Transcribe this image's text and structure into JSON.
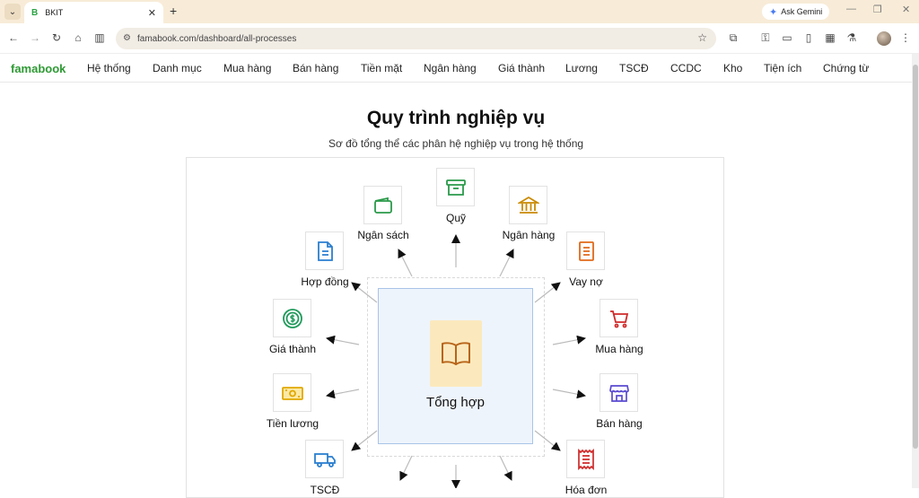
{
  "browser": {
    "tab_title": "BKIT",
    "tab_favicon": "B",
    "url": "famabook.com/dashboard/all-processes",
    "gemini_label": "Ask Gemini"
  },
  "nav": {
    "brand": "famabook",
    "items": [
      "Hệ thống",
      "Danh mục",
      "Mua hàng",
      "Bán hàng",
      "Tiền mặt",
      "Ngân hàng",
      "Giá thành",
      "Lương",
      "TSCĐ",
      "CCDC",
      "Kho",
      "Tiện ích",
      "Chứng từ"
    ]
  },
  "page": {
    "title": "Quy trình nghiệp vụ",
    "subtitle": "Sơ đồ tổng thể các phân hệ nghiệp vụ trong hệ thống",
    "center_label": "Tổng hợp"
  },
  "nodes": [
    {
      "label": "Quỹ",
      "icon": "archive-icon",
      "color": "#2a9a4a"
    },
    {
      "label": "Ngân sách",
      "icon": "wallet-icon",
      "color": "#2a9a4a"
    },
    {
      "label": "Ngân hàng",
      "icon": "bank-icon",
      "color": "#c98a00"
    },
    {
      "label": "Hợp đồng",
      "icon": "document-icon",
      "color": "#2a7fd0"
    },
    {
      "label": "Vay nợ",
      "icon": "document-icon",
      "color": "#e06a1a"
    },
    {
      "label": "Giá thành",
      "icon": "dollar-circle-icon",
      "color": "#1f9a5a"
    },
    {
      "label": "Mua hàng",
      "icon": "cart-icon",
      "color": "#d02a2a"
    },
    {
      "label": "Tiền lương",
      "icon": "banknote-icon",
      "color": "#e0a800"
    },
    {
      "label": "Bán hàng",
      "icon": "store-icon",
      "color": "#5a4ad0"
    },
    {
      "label": "TSCĐ",
      "icon": "truck-icon",
      "color": "#2a7fd0"
    },
    {
      "label": "Hóa đơn",
      "icon": "receipt-icon",
      "color": "#d02a2a"
    }
  ],
  "colors": {
    "brand": "#2e9a34",
    "center_fill": "#eef4fc",
    "center_border": "#a9c4e8",
    "center_icon_bg": "#fbe9bd",
    "center_icon": "#b8651a"
  }
}
